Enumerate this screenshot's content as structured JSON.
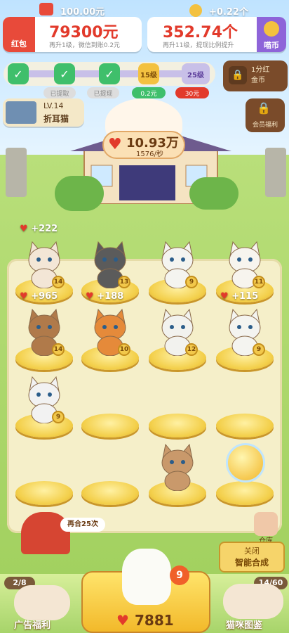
{
  "top": {
    "floating_cash": "100.00元",
    "floating_coin": "+0.22个",
    "cash_label": "红包",
    "cash_value": "79300元",
    "cash_hint": "再升1级，微信到账0.2元",
    "coin_value": "352.74个",
    "coin_hint": "再升11级，提现比例提升",
    "coin_btn_label": "喵币"
  },
  "progress": {
    "levels": [
      "15级",
      "25级"
    ],
    "status_claimed_1": "已提取",
    "status_claimed_2": "已提现",
    "reward_1": "0.2元",
    "reward_2": "30元",
    "bonus_title": "1分红",
    "bonus_sub": "金币"
  },
  "player": {
    "level": "LV.14",
    "cat_name": "折耳猫"
  },
  "vip_label": "会员福利",
  "hearts": {
    "total": "10.93万",
    "rate": "1576/秒"
  },
  "board": {
    "cats": [
      {
        "level": "14",
        "gain": "+222"
      },
      {
        "level": "13"
      },
      {
        "level": "9"
      },
      {
        "level": "11"
      },
      {
        "level": "14",
        "gain": "+965"
      },
      {
        "level": "10",
        "gain": "+188"
      },
      {
        "level": "12"
      },
      {
        "level": "9",
        "gain": "+115"
      },
      {
        "level": "9"
      },
      {
        "level": ""
      }
    ]
  },
  "merge_hint": "再合25次",
  "warehouse_label": "仓库",
  "auto_merge": {
    "title": "关闭",
    "label": "智能合成"
  },
  "bottom": {
    "ad_count": "2/8",
    "ad_label": "广告福利",
    "buy_count": "9",
    "buy_price": "7881",
    "atlas_count": "14/60",
    "atlas_label": "猫咪图鉴"
  },
  "colors": {
    "accent_red": "#e23a2b",
    "gold": "#f3cf4a",
    "purple": "#8e64d9"
  }
}
